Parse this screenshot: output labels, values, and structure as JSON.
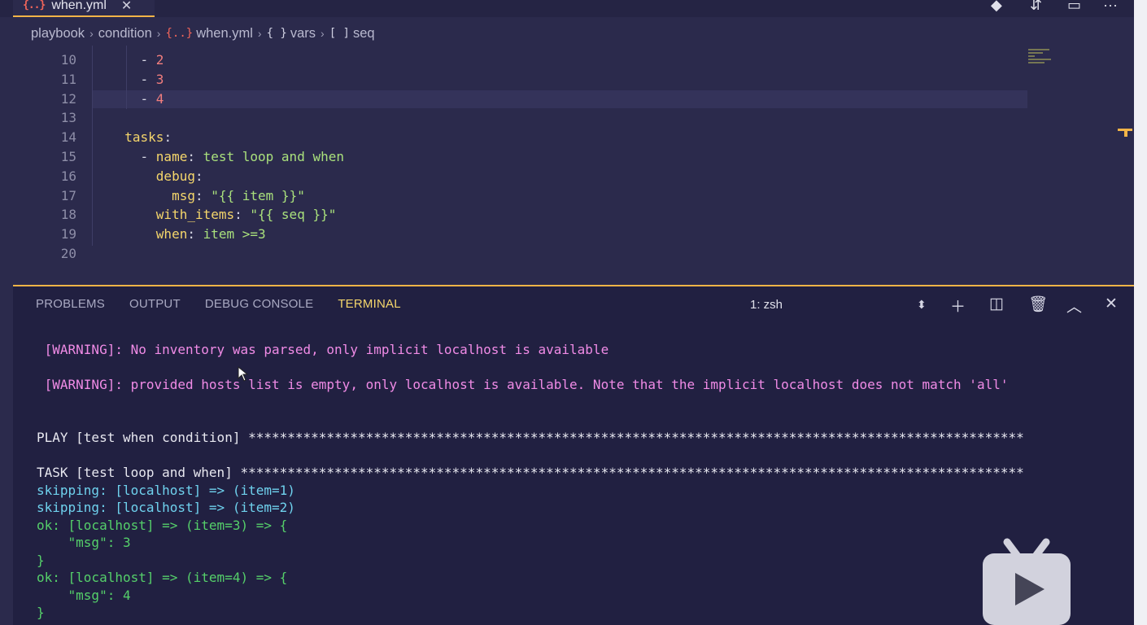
{
  "tab": {
    "icon": "{..}",
    "label": "when.yml",
    "close": "✕"
  },
  "breadcrumb": {
    "items": [
      "playbook",
      "condition",
      "when.yml",
      "vars",
      "seq"
    ],
    "icons": [
      "",
      "",
      "{..}",
      "{ }",
      "[ ]"
    ],
    "separator": "›"
  },
  "editor": {
    "lines": [
      {
        "num": "10",
        "parts": [
          [
            "d",
            "    - "
          ],
          [
            "n",
            "2"
          ]
        ]
      },
      {
        "num": "11",
        "parts": [
          [
            "d",
            "    - "
          ],
          [
            "n",
            "3"
          ]
        ]
      },
      {
        "num": "12",
        "parts": [
          [
            "d",
            "    - "
          ],
          [
            "n",
            "4"
          ]
        ]
      },
      {
        "num": "13",
        "parts": []
      },
      {
        "num": "14",
        "parts": [
          [
            "k",
            "  tasks"
          ],
          [
            "d",
            ":"
          ]
        ]
      },
      {
        "num": "15",
        "parts": [
          [
            "d",
            "    - "
          ],
          [
            "k",
            "name"
          ],
          [
            "d",
            ": "
          ],
          [
            "s",
            "test loop and when"
          ]
        ]
      },
      {
        "num": "16",
        "parts": [
          [
            "k",
            "      debug"
          ],
          [
            "d",
            ":"
          ]
        ]
      },
      {
        "num": "17",
        "parts": [
          [
            "k",
            "        msg"
          ],
          [
            "d",
            ": "
          ],
          [
            "s",
            "\"{{ item }}\""
          ]
        ]
      },
      {
        "num": "18",
        "parts": [
          [
            "k",
            "      with_items"
          ],
          [
            "d",
            ": "
          ],
          [
            "s",
            "\"{{ seq }}\""
          ]
        ]
      },
      {
        "num": "19",
        "parts": [
          [
            "k",
            "      when"
          ],
          [
            "d",
            ": "
          ],
          [
            "s",
            "item >=3"
          ]
        ]
      },
      {
        "num": "20",
        "parts": []
      }
    ]
  },
  "panel": {
    "tabs": [
      "PROBLEMS",
      "OUTPUT",
      "DEBUG CONSOLE",
      "TERMINAL"
    ],
    "active_tab": "TERMINAL",
    "terminal_select": "1: zsh",
    "icons": [
      "select-arrows-icon",
      "plus-icon",
      "split-icon",
      "trash-icon",
      "chevron-up-icon",
      "close-icon"
    ]
  },
  "terminal": {
    "lines": [
      {
        "cls": "warn",
        "text": " [WARNING]: No inventory was parsed, only implicit localhost is available"
      },
      {
        "cls": "warn",
        "text": " [WARNING]: provided hosts list is empty, only localhost is available. Note that the implicit localhost does not match 'all'"
      },
      {
        "cls": "white",
        "text": "PLAY [test when condition] ***************************************************************************************************"
      },
      {
        "cls": "white",
        "text": "TASK [test loop and when] ****************************************************************************************************"
      },
      {
        "cls": "skip",
        "text": "skipping: [localhost] => (item=1)"
      },
      {
        "cls": "skip",
        "text": "skipping: [localhost] => (item=2)"
      },
      {
        "cls": "ok",
        "text": "ok: [localhost] => (item=3) => {"
      },
      {
        "cls": "ok",
        "text": "    \"msg\": 3"
      },
      {
        "cls": "ok",
        "text": "}"
      },
      {
        "cls": "ok",
        "text": "ok: [localhost] => (item=4) => {"
      },
      {
        "cls": "ok",
        "text": "    \"msg\": 4"
      },
      {
        "cls": "ok",
        "text": "}"
      }
    ]
  },
  "colors": {
    "accent": "#f2b447",
    "key": "#f5d66b",
    "string": "#a9e07c",
    "number": "#f27e7e",
    "warning": "#f08be6",
    "skipping": "#6fd2ee",
    "ok": "#55d06a"
  }
}
